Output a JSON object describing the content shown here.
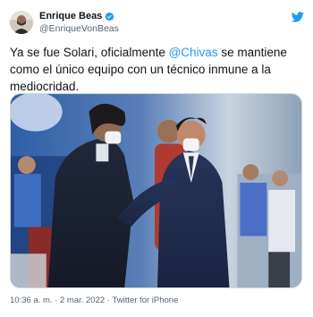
{
  "author": {
    "name": "Enrique Beas",
    "handle": "@EnriqueVonBeas"
  },
  "tweet": {
    "text_before": "Ya se fue Solari, oficialmente ",
    "mention": "@Chivas",
    "text_after": " se mantiene como el único equipo con un técnico inmune a la mediocridad."
  },
  "meta": {
    "time": "10:36 a. m.",
    "separator1": " · ",
    "date": "2 mar. 2022",
    "separator2": " · ",
    "source": "Twitter for iPhone"
  },
  "colors": {
    "accent": "#1d9bf0",
    "text": "#0f1419",
    "secondary": "#536471"
  },
  "icons": {
    "verified": "verified-badge-icon",
    "brand": "twitter-bird-icon"
  }
}
